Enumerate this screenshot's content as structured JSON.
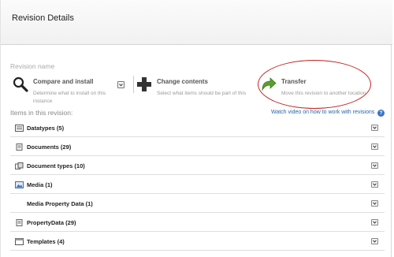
{
  "header": {
    "title": "Revision Details"
  },
  "revision": {
    "name_label": "Revision name"
  },
  "actions": [
    {
      "title": "Compare and install",
      "description": "Determine what to install on this instance",
      "icon": "magnifier-icon"
    },
    {
      "title": "Change contents",
      "description": "Select what items should be part of this",
      "icon": "plus-icon"
    },
    {
      "title": "Transfer",
      "description": "Move this revision to another location",
      "icon": "arrow-icon"
    }
  ],
  "items": {
    "title": "Items in this revision:",
    "video_link": "Watch video on how to work with revisions",
    "help_glyph": "?",
    "rows": [
      {
        "label": "Datatypes (5)",
        "icon": "datatype-icon"
      },
      {
        "label": "Documents (29)",
        "icon": "document-icon"
      },
      {
        "label": "Document types (10)",
        "icon": "document-types-icon"
      },
      {
        "label": "Media (1)",
        "icon": "media-icon"
      },
      {
        "label": "Media Property Data (1)",
        "icon": ""
      },
      {
        "label": "PropertyData (29)",
        "icon": "property-data-icon"
      },
      {
        "label": "Templates (4)",
        "icon": "template-icon"
      }
    ]
  },
  "colors": {
    "link": "#2a64a8",
    "annotation": "#c22222",
    "transfer_green": "#5aa02c"
  }
}
